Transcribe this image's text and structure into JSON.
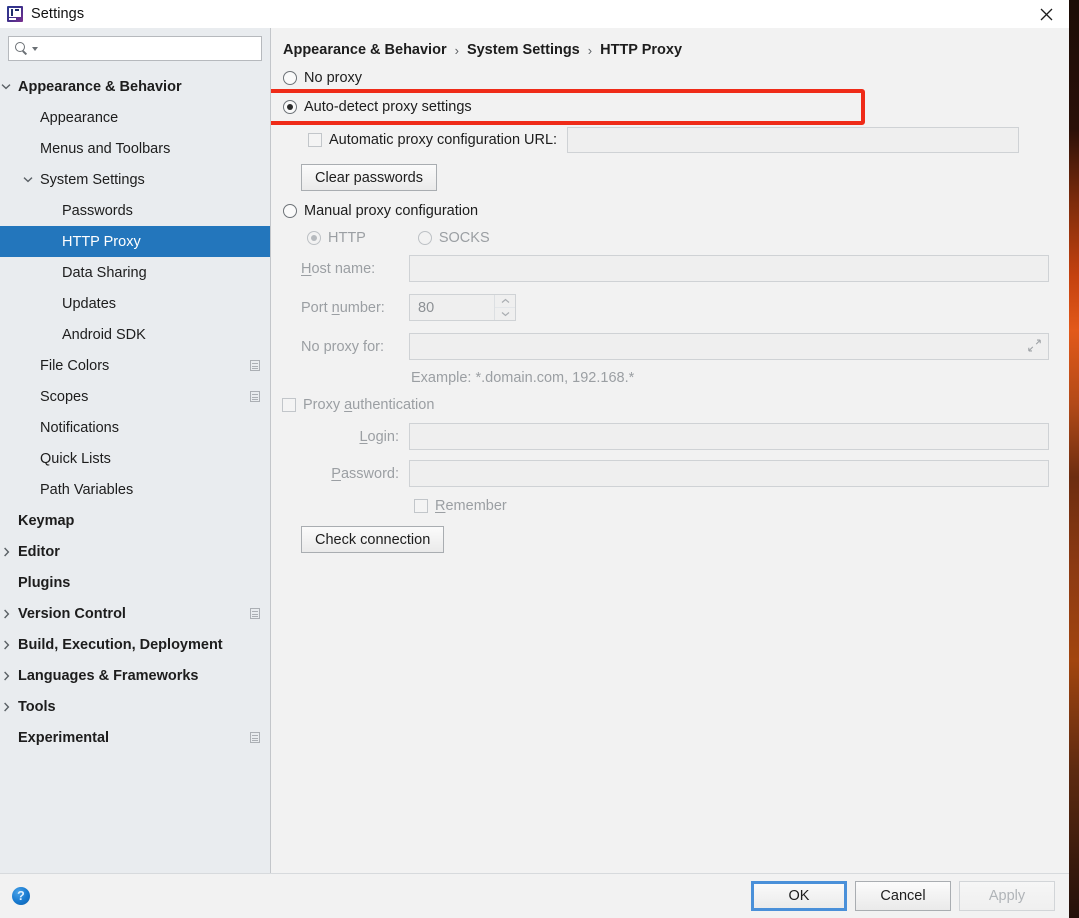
{
  "window": {
    "title": "Settings",
    "app_icon": "intellij-idea-icon",
    "close_icon": "close-icon"
  },
  "sidebar": {
    "search": {
      "value": "",
      "placeholder": "",
      "icon": "search-icon"
    },
    "items": [
      {
        "label": "Appearance & Behavior",
        "indent": 0,
        "bold": true,
        "twisty": "down",
        "selected": false,
        "scope_icon": false
      },
      {
        "label": "Appearance",
        "indent": 1,
        "bold": false,
        "twisty": "none",
        "selected": false,
        "scope_icon": false
      },
      {
        "label": "Menus and Toolbars",
        "indent": 1,
        "bold": false,
        "twisty": "none",
        "selected": false,
        "scope_icon": false
      },
      {
        "label": "System Settings",
        "indent": 1,
        "bold": false,
        "twisty": "down",
        "selected": false,
        "scope_icon": false
      },
      {
        "label": "Passwords",
        "indent": 2,
        "bold": false,
        "twisty": "none",
        "selected": false,
        "scope_icon": false
      },
      {
        "label": "HTTP Proxy",
        "indent": 2,
        "bold": false,
        "twisty": "none",
        "selected": true,
        "scope_icon": false
      },
      {
        "label": "Data Sharing",
        "indent": 2,
        "bold": false,
        "twisty": "none",
        "selected": false,
        "scope_icon": false
      },
      {
        "label": "Updates",
        "indent": 2,
        "bold": false,
        "twisty": "none",
        "selected": false,
        "scope_icon": false
      },
      {
        "label": "Android SDK",
        "indent": 2,
        "bold": false,
        "twisty": "none",
        "selected": false,
        "scope_icon": false
      },
      {
        "label": "File Colors",
        "indent": 1,
        "bold": false,
        "twisty": "none",
        "selected": false,
        "scope_icon": true
      },
      {
        "label": "Scopes",
        "indent": 1,
        "bold": false,
        "twisty": "none",
        "selected": false,
        "scope_icon": true
      },
      {
        "label": "Notifications",
        "indent": 1,
        "bold": false,
        "twisty": "none",
        "selected": false,
        "scope_icon": false
      },
      {
        "label": "Quick Lists",
        "indent": 1,
        "bold": false,
        "twisty": "none",
        "selected": false,
        "scope_icon": false
      },
      {
        "label": "Path Variables",
        "indent": 1,
        "bold": false,
        "twisty": "none",
        "selected": false,
        "scope_icon": false
      },
      {
        "label": "Keymap",
        "indent": 0,
        "bold": true,
        "twisty": "none",
        "selected": false,
        "scope_icon": false
      },
      {
        "label": "Editor",
        "indent": 0,
        "bold": true,
        "twisty": "right",
        "selected": false,
        "scope_icon": false
      },
      {
        "label": "Plugins",
        "indent": 0,
        "bold": true,
        "twisty": "none",
        "selected": false,
        "scope_icon": false
      },
      {
        "label": "Version Control",
        "indent": 0,
        "bold": true,
        "twisty": "right",
        "selected": false,
        "scope_icon": true
      },
      {
        "label": "Build, Execution, Deployment",
        "indent": 0,
        "bold": true,
        "twisty": "right",
        "selected": false,
        "scope_icon": false
      },
      {
        "label": "Languages & Frameworks",
        "indent": 0,
        "bold": true,
        "twisty": "right",
        "selected": false,
        "scope_icon": false
      },
      {
        "label": "Tools",
        "indent": 0,
        "bold": true,
        "twisty": "right",
        "selected": false,
        "scope_icon": false
      },
      {
        "label": "Experimental",
        "indent": 0,
        "bold": true,
        "twisty": "none",
        "selected": false,
        "scope_icon": true
      }
    ]
  },
  "breadcrumb": {
    "part1": "Appearance & Behavior",
    "part2": "System Settings",
    "part3": "HTTP Proxy",
    "separator": "›"
  },
  "proxy": {
    "no_proxy": {
      "label": "No proxy",
      "selected": false
    },
    "auto_detect": {
      "label": "Auto-detect proxy settings",
      "selected": true
    },
    "auto_config_url": {
      "label": "Automatic proxy configuration URL:",
      "checked": false,
      "value": "",
      "placeholder": ""
    },
    "clear_passwords_label": "Clear passwords",
    "manual": {
      "label": "Manual proxy configuration",
      "selected": false
    },
    "protocol": {
      "http": {
        "label": "HTTP",
        "selected": true
      },
      "socks": {
        "label": "SOCKS",
        "selected": false
      }
    },
    "host_name": {
      "label_a": "H",
      "label_b": "ost name:",
      "value": "",
      "placeholder": ""
    },
    "port_number": {
      "label_a": "Port ",
      "label_b": "n",
      "label_c": "umber:",
      "value": "80"
    },
    "no_proxy_for": {
      "label": "No proxy for:",
      "value": "",
      "placeholder": "",
      "expand_icon": "expand-icon"
    },
    "example_hint": "Example: *.domain.com, 192.168.*",
    "proxy_auth": {
      "label_a": "Proxy ",
      "label_b": "a",
      "label_c": "uthentication",
      "checked": false
    },
    "login": {
      "label_a": "L",
      "label_b": "ogin:",
      "value": "",
      "placeholder": ""
    },
    "password": {
      "label_a": "P",
      "label_b": "assword:",
      "value": "",
      "placeholder": ""
    },
    "remember": {
      "label_a": "R",
      "label_b": "emember",
      "checked": false
    },
    "check_connection_label": "Check connection"
  },
  "annotation": {
    "color": "#ef2b18",
    "target": "auto-detect-proxy-settings-row"
  },
  "footer": {
    "help_icon": "help-icon",
    "help_glyph": "?",
    "ok_label": "OK",
    "cancel_label": "Cancel",
    "apply_label": "Apply",
    "apply_disabled": true
  }
}
